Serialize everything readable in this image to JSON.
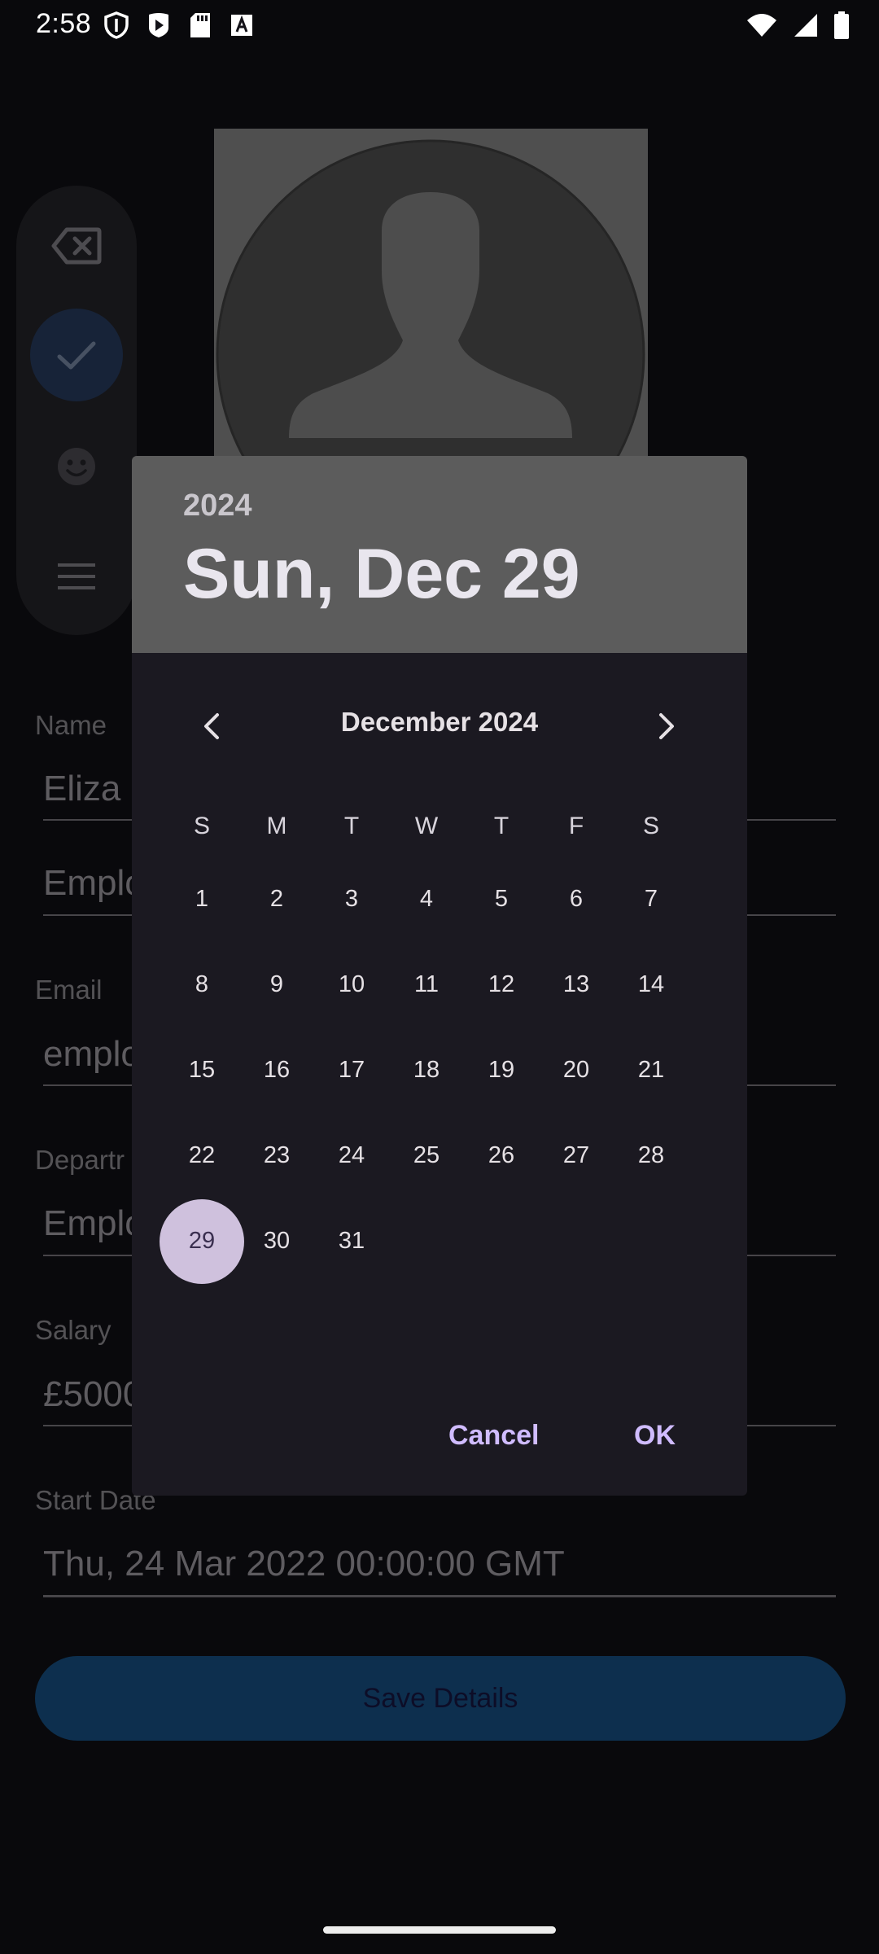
{
  "status_bar": {
    "time": "2:58",
    "left_icons": [
      "shield-icon",
      "play-store-icon",
      "sd-card-icon",
      "font-icon"
    ],
    "right_icons": [
      "wifi-icon",
      "signal-icon",
      "battery-icon"
    ]
  },
  "background_form": {
    "rail_icons": [
      "backspace-icon",
      "check-icon",
      "emoji-icon",
      "menu-icon"
    ],
    "fields": [
      {
        "label": "Name",
        "value": "Eliza"
      },
      {
        "label": "",
        "value": "Emplo"
      },
      {
        "label": "Email",
        "value": "emplo"
      },
      {
        "label": "Departr",
        "value": "Emplo"
      },
      {
        "label": "Salary",
        "value": "£5000"
      },
      {
        "label": "Start Date",
        "value": "Thu, 24 Mar 2022 00:00:00 GMT"
      }
    ],
    "save_button": "Save Details"
  },
  "date_picker": {
    "year": "2024",
    "selected_date": "Sun, Dec 29",
    "month_label": "December 2024",
    "weekdays": [
      "S",
      "M",
      "T",
      "W",
      "T",
      "F",
      "S"
    ],
    "weeks": [
      [
        "1",
        "2",
        "3",
        "4",
        "5",
        "6",
        "7"
      ],
      [
        "8",
        "9",
        "10",
        "11",
        "12",
        "13",
        "14"
      ],
      [
        "15",
        "16",
        "17",
        "18",
        "19",
        "20",
        "21"
      ],
      [
        "22",
        "23",
        "24",
        "25",
        "26",
        "27",
        "28"
      ],
      [
        "29",
        "30",
        "31",
        "",
        "",
        "",
        ""
      ]
    ],
    "selected_day": "29",
    "cancel_label": "Cancel",
    "ok_label": "OK"
  },
  "colors": {
    "accent": "#d0bcff",
    "selected_day_bg": "#cfc1dd",
    "header_bg": "#5c5c5c",
    "dialog_bg": "#1b1921",
    "save_button_bg": "#1a5f9c"
  }
}
